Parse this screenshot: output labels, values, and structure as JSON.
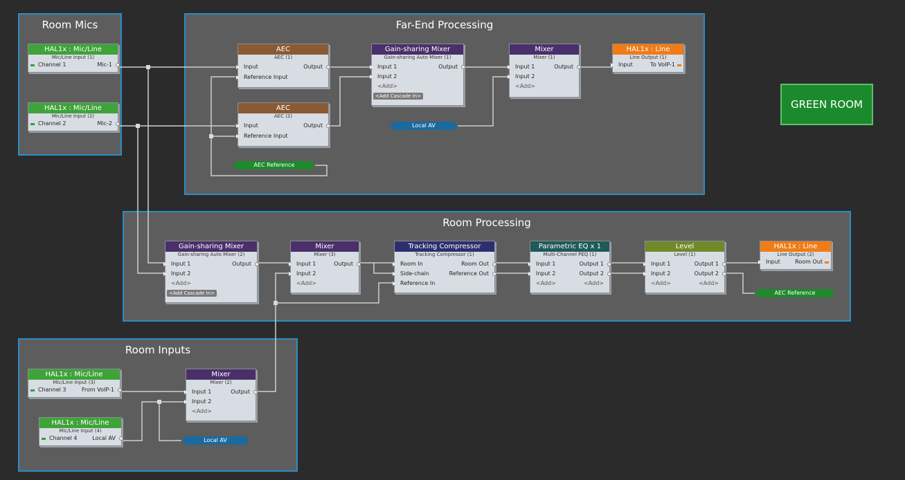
{
  "colors": {
    "canvas": "#2b2b2b",
    "group_bg": "#5d5d5d",
    "group_border": "#2c8cc4",
    "mic_input": "#3fa33a",
    "line_output": "#f07c17",
    "aec": "#8a5a34",
    "mixer": "#4a2f6a",
    "compressor": "#2c2f6e",
    "peq": "#1f5a58",
    "level": "#708a2a",
    "tag_green": "#1e8a2c",
    "tag_blue": "#1a6aa0",
    "green_room": "#1b8a2d"
  },
  "groups": {
    "room_mics": "Room Mics",
    "far_end": "Far-End Processing",
    "room_processing": "Room Processing",
    "room_inputs": "Room Inputs"
  },
  "green_room_label": "GREEN ROOM",
  "blocks": {
    "mic1": {
      "title": "HAL1x : Mic/Line",
      "subtitle": "Mic/Line Input (1)",
      "left_label": "Channel 1",
      "right_label": "Mic-1"
    },
    "mic2": {
      "title": "HAL1x : Mic/Line",
      "subtitle": "Mic/Line Input (2)",
      "left_label": "Channel 2",
      "right_label": "Mic-2"
    },
    "mic3": {
      "title": "HAL1x : Mic/Line",
      "subtitle": "Mic/Line Input (3)",
      "left_label": "Channel 3",
      "right_label": "From VoIP-1"
    },
    "mic4": {
      "title": "HAL1x : Mic/Line",
      "subtitle": "Mic/Line Input (4)",
      "left_label": "Channel 4",
      "right_label": "Local AV"
    },
    "aec1": {
      "title": "AEC",
      "subtitle": "AEC (1)",
      "in1": "Input",
      "in2": "Reference Input",
      "out1": "Output"
    },
    "aec2": {
      "title": "AEC",
      "subtitle": "AEC (2)",
      "in1": "Input",
      "in2": "Reference Input",
      "out1": "Output"
    },
    "gsm1": {
      "title": "Gain-sharing Mixer",
      "subtitle": "Gain-sharing Auto Mixer (1)",
      "in1": "Input 1",
      "in2": "Input 2",
      "add": "<Add>",
      "cascade": "<Add Cascade In>",
      "out1": "Output"
    },
    "mix1": {
      "title": "Mixer",
      "subtitle": "Mixer (1)",
      "in1": "Input 1",
      "in2": "Input 2",
      "add": "<Add>",
      "out1": "Output"
    },
    "lo1": {
      "title": "HAL1x : Line",
      "subtitle": "Line Output (1)",
      "left_label": "Input",
      "right_label": "To VoIP-1"
    },
    "gsm2": {
      "title": "Gain-sharing Mixer",
      "subtitle": "Gain-sharing Auto Mixer (2)",
      "in1": "Input 1",
      "in2": "Input 2",
      "add": "<Add>",
      "cascade": "<Add Cascade In>",
      "out1": "Output"
    },
    "mix3": {
      "title": "Mixer",
      "subtitle": "Mixer (3)",
      "in1": "Input 1",
      "in2": "Input 2",
      "add": "<Add>",
      "out1": "Output"
    },
    "tc1": {
      "title": "Tracking Compressor",
      "subtitle": "Tracking Compressor (1)",
      "in1": "Room In",
      "in2": "Side-chain",
      "in3": "Reference In",
      "out1": "Room Out",
      "out2": "Reference Out"
    },
    "peq1": {
      "title": "Parametric EQ x 1",
      "subtitle": "Multi-Channel PEQ (1)",
      "in1": "Input 1",
      "in2": "Input 2",
      "add": "<Add>",
      "out1": "Output 1",
      "out2": "Output 2",
      "add_out": "<Add>"
    },
    "lvl1": {
      "title": "Level",
      "subtitle": "Level (1)",
      "in1": "Input 1",
      "in2": "Input 2",
      "add": "<Add>",
      "out1": "Output 1",
      "out2": "Output 2",
      "add_out": "<Add>"
    },
    "lo2": {
      "title": "HAL1x : Line",
      "subtitle": "Line Output (2)",
      "left_label": "Input",
      "right_label": "Room Out"
    },
    "mix2": {
      "title": "Mixer",
      "subtitle": "Mixer (2)",
      "in1": "Input 1",
      "in2": "Input 2",
      "add": "<Add>",
      "out1": "Output"
    }
  },
  "tags": {
    "local_av_1": "Local AV",
    "aec_reference_1": "AEC Reference",
    "aec_reference_2": "AEC Reference",
    "local_av_2": "Local AV"
  }
}
